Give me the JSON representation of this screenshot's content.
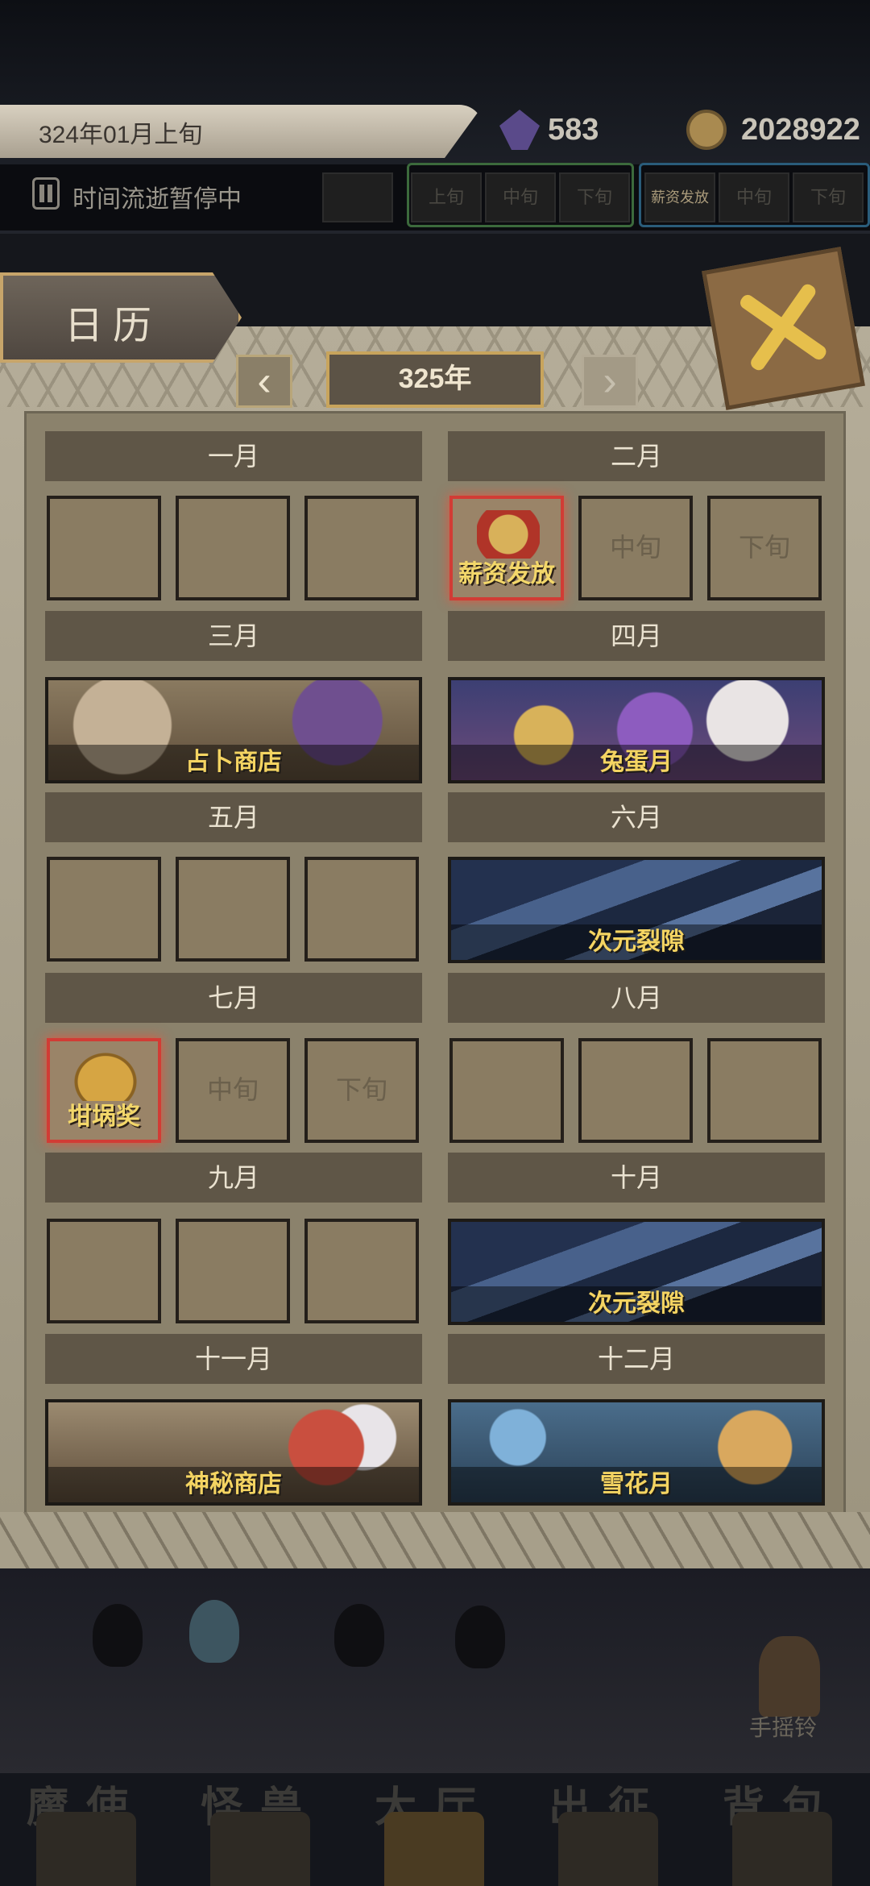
{
  "status": {
    "date": "324年01月上旬",
    "crystals": "583",
    "gold": "2028922",
    "pause_text": "时间流逝暂停中",
    "timeline": [
      "上旬",
      "中旬",
      "下旬",
      "薪资发放",
      "中旬",
      "下旬"
    ]
  },
  "panel": {
    "title": "日历",
    "year": "325年",
    "prev_icon": "chevron-left-icon",
    "next_icon": "chevron-right-icon"
  },
  "months": [
    {
      "name": "一月",
      "slots": [
        "",
        "",
        ""
      ]
    },
    {
      "name": "二月",
      "slots": [
        "薪资发放",
        "中旬",
        "下旬"
      ]
    },
    {
      "name": "三月",
      "event": "占卜商店"
    },
    {
      "name": "四月",
      "event": "兔蛋月"
    },
    {
      "name": "五月",
      "slots": [
        "",
        "",
        ""
      ]
    },
    {
      "name": "六月",
      "event": "次元裂隙"
    },
    {
      "name": "七月",
      "slots": [
        "坩埚奖",
        "中旬",
        "下旬"
      ]
    },
    {
      "name": "八月",
      "slots": [
        "",
        "",
        ""
      ]
    },
    {
      "name": "九月",
      "slots": [
        "",
        "",
        ""
      ]
    },
    {
      "name": "十月",
      "event": "次元裂隙"
    },
    {
      "name": "十一月",
      "event": "神秘商店"
    },
    {
      "name": "十二月",
      "event": "雪花月"
    }
  ],
  "bell_label": "手摇铃",
  "bottom_nav": [
    "魔使",
    "怪兽",
    "大厅",
    "出征",
    "背包"
  ],
  "colors": {
    "accent": "#f4d462",
    "active_border": "#d13c35"
  }
}
